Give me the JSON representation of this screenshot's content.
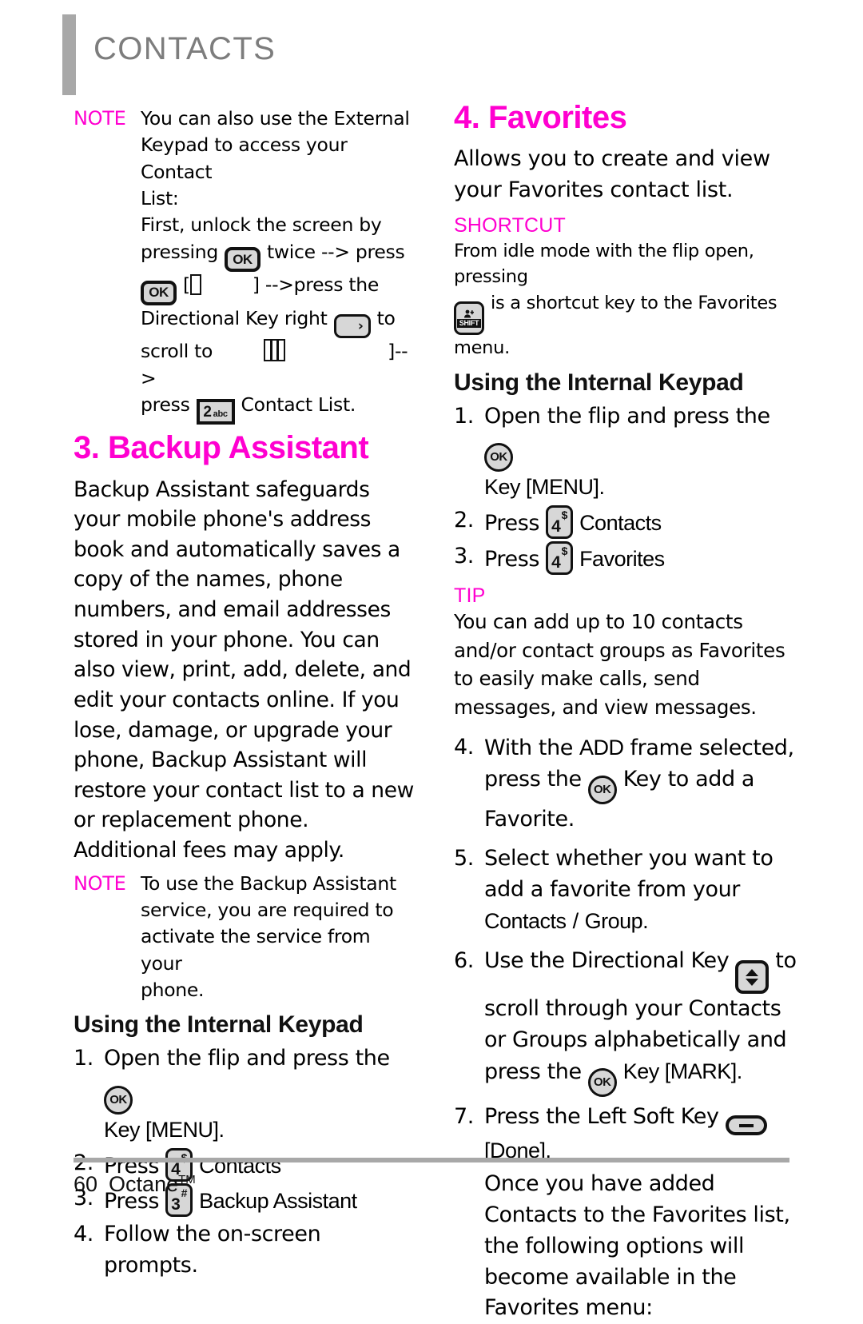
{
  "header": {
    "title": "CONTACTS"
  },
  "colors": {
    "accent_pink": "#ff00d0",
    "header_gray": "#7d7d7d",
    "rule_gray": "#a8a8a8",
    "key_fill": "#d7d7d7",
    "text": "#000000"
  },
  "footer": {
    "page_number": "60",
    "product": "Octane",
    "trademark": "TM"
  },
  "left_column": {
    "note_external_keypad": {
      "label": "NOTE",
      "line1": "You can also use the External",
      "line2": "Keypad to access your Contact",
      "line3": "List:",
      "line4": "First, unlock the screen by",
      "line5_a": "pressing",
      "key_ok_1": "OK",
      "line5_b": "twice --> press",
      "key_ok_2": "OK",
      "line6_a": "[",
      "line6_b": "] -->press the",
      "line7_a": "Directional Key right",
      "key_dir_right": "directional-key-right",
      "line7_b": "to",
      "line8_a": "scroll to",
      "line8_b": "]-->",
      "line9_a": "press",
      "key_2abc_digit": "2",
      "key_2abc_letters": "abc",
      "line9_b": "Contact List."
    },
    "section": {
      "heading": "3. Backup Assistant",
      "paragraph": "Backup Assistant safeguards your mobile phone's address book and automatically saves a copy of the names, phone numbers, and email addresses stored in your phone. You can also view, print, add, delete, and edit your contacts online. If you lose, damage, or upgrade your phone, Backup Assistant will restore your contact list to a new or replacement phone. Additional fees may apply."
    },
    "note_service": {
      "label": "NOTE",
      "line1": "To use the Backup Assistant",
      "line2": "service, you are required to",
      "line3": "activate the service from your",
      "line4": "phone."
    },
    "keypad_heading": "Using the Internal Keypad",
    "steps": [
      {
        "num": "1.",
        "text_a": "Open the flip and press the",
        "key": "ok-round",
        "text_b": "Key [MENU]."
      },
      {
        "num": "2.",
        "text_a": "Press",
        "key_digit": "4",
        "key_sup": "$",
        "text_b": "Contacts"
      },
      {
        "num": "3.",
        "text_a": "Press",
        "key_digit": "3",
        "key_sup": "#",
        "text_b": "Backup Assistant"
      },
      {
        "num": "4.",
        "text_a": "Follow the on-screen prompts."
      }
    ]
  },
  "right_column": {
    "section": {
      "heading": "4. Favorites",
      "intro": "Allows you to create and view your Favorites contact list."
    },
    "shortcut": {
      "label": "SHORTCUT",
      "line1": "From idle mode with the flip open, pressing",
      "key": "SHIFT",
      "line2": "is a shortcut key  to the Favorites menu."
    },
    "keypad_heading": "Using the Internal Keypad",
    "steps": [
      {
        "num": "1.",
        "text_a": "Open the flip and press the",
        "key": "ok-round",
        "text_b": "Key [MENU]."
      },
      {
        "num": "2.",
        "text_a": "Press",
        "key_digit": "4",
        "key_sup": "$",
        "text_b": "Contacts"
      },
      {
        "num": "3.",
        "text_a": "Press",
        "key_digit": "4",
        "key_sup": "$",
        "text_b": "Favorites"
      }
    ],
    "tip": {
      "label": "TIP",
      "text": "You can add up to 10 contacts and/or contact groups as Favorites to easily make calls, send messages, and view messages."
    },
    "steps2": [
      {
        "num": "4.",
        "text_a": "With the",
        "ui_a": "ADD",
        "text_b": "frame selected, press the",
        "key": "ok-round",
        "text_c": "Key to add a Favorite."
      },
      {
        "num": "5.",
        "text_a": "Select whether you want to add a favorite from your",
        "ui_a": "Contacts",
        "text_b": "/",
        "ui_b": "Group",
        "text_c": "."
      },
      {
        "num": "6.",
        "text_a": "Use the Directional Key",
        "key_dir": "directional-key-up-down",
        "text_b": "to scroll through your Contacts or Groups alphabetically and press the",
        "key_ok": "ok-round",
        "text_c": "Key [MARK]."
      },
      {
        "num": "7.",
        "text_a": "Press the Left Soft Key",
        "key_soft": "left-soft-key",
        "text_b": "[Done]."
      }
    ],
    "closing": "Once you have added Contacts to the Favorites list, the following options will become available in the Favorites menu:"
  }
}
